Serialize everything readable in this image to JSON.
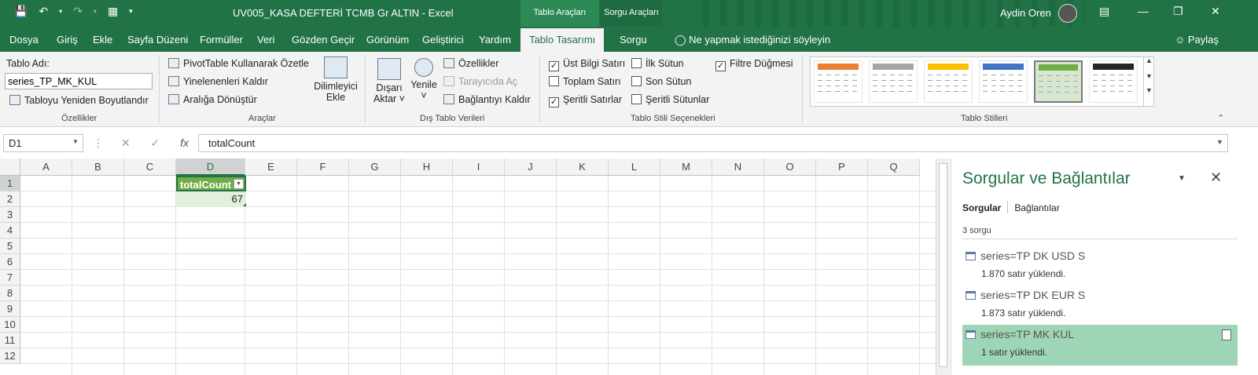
{
  "window": {
    "doc_title": "UV005_KASA DEFTERİ TCMB Gr ALTIN  -  Excel",
    "context_tab_tablo": "Tablo Araçları",
    "context_tab_sorgu": "Sorgu Araçları",
    "user_name": "Aydin Oren"
  },
  "ribbon_tabs": {
    "dosya": "Dosya",
    "giris": "Giriş",
    "ekle": "Ekle",
    "sayfa_duzeni": "Sayfa Düzeni",
    "formuller": "Formüller",
    "veri": "Veri",
    "gozden_gecir": "Gözden Geçir",
    "gorunum": "Görünüm",
    "gelistirici": "Geliştirici",
    "yardim": "Yardım",
    "tablo_tasarimi": "Tablo Tasarımı",
    "sorgu": "Sorgu",
    "tell_me": "Ne yapmak istediğinizi söyleyin",
    "share": "Paylaş"
  },
  "ribbon": {
    "ozellikler": {
      "table_name_label": "Tablo Adı:",
      "table_name_value": "series_TP_MK_KUL",
      "resize": "Tabloyu Yeniden Boyutlandır",
      "group_label": "Özellikler"
    },
    "araclar": {
      "pivot": "PivotTable Kullanarak Özetle",
      "remove_dup": "Yinelenenleri Kaldır",
      "convert": "Aralığa Dönüştür",
      "slicer_line1": "Dilimleyici",
      "slicer_line2": "Ekle",
      "group_label": "Araçlar"
    },
    "dis_tablo": {
      "export_line1": "Dışarı",
      "export_line2": "Aktar ˅",
      "refresh_line1": "Yenile",
      "refresh_line2": "˅",
      "properties": "Özellikler",
      "open_browser": "Tarayıcıda Aç",
      "unlink": "Bağlantıyı Kaldır",
      "group_label": "Dış Tablo Verileri"
    },
    "stil_secenekleri": {
      "header_row": "Üst Bilgi Satırı",
      "total_row": "Toplam Satırı",
      "banded_rows": "Şeritli Satırlar",
      "first_col": "İlk Sütun",
      "last_col": "Son Sütun",
      "banded_cols": "Şeritli Sütunlar",
      "filter_btn": "Filtre Düğmesi",
      "group_label": "Tablo Stili Seçenekleri",
      "checked_header_row": true,
      "checked_total_row": false,
      "checked_banded_rows": true,
      "checked_first_col": false,
      "checked_last_col": false,
      "checked_banded_cols": false,
      "checked_filter_btn": true
    },
    "stiller": {
      "group_label": "Tablo Stilleri",
      "tile_colors": [
        "#ed7d31",
        "#a5a5a5",
        "#ffc000",
        "#4472c4",
        "#70ad47",
        "#262626"
      ],
      "selected_index": 4
    }
  },
  "formula_bar": {
    "name_box": "D1",
    "formula": "totalCount",
    "fx": "fx"
  },
  "sheet": {
    "columns": [
      "A",
      "B",
      "C",
      "D",
      "E",
      "F",
      "G",
      "H",
      "I",
      "J",
      "K",
      "L",
      "M",
      "N",
      "O",
      "P",
      "Q"
    ],
    "rows": [
      "1",
      "2",
      "3",
      "4",
      "5",
      "6",
      "7",
      "8",
      "9",
      "10",
      "11",
      "12"
    ],
    "d1": "totalCount",
    "d2": "67"
  },
  "queries_pane": {
    "title": "Sorgular ve Bağlantılar",
    "tab_queries": "Sorgular",
    "tab_connections": "Bağlantılar",
    "count": "3 sorgu",
    "items": [
      {
        "name": "series=TP DK USD S",
        "status": "1.870 satır yüklendi."
      },
      {
        "name": "series=TP DK EUR S",
        "status": "1.873 satır yüklendi."
      },
      {
        "name": "series=TP MK KUL",
        "status": "1 satır yüklendi."
      }
    ]
  },
  "icons": {
    "save": "save-icon",
    "undo": "undo-icon",
    "redo": "redo-icon",
    "form": "form-icon",
    "customize": "customize-qat-icon",
    "lightbulb": "lightbulb-icon",
    "share": "person-add-icon",
    "table": "table-icon",
    "filter": "filter-dropdown-icon"
  },
  "colors": {
    "excel_green": "#217346",
    "table_header": "#70ad47",
    "table_band": "#e2efda",
    "selected_query": "#9fd5b7"
  }
}
